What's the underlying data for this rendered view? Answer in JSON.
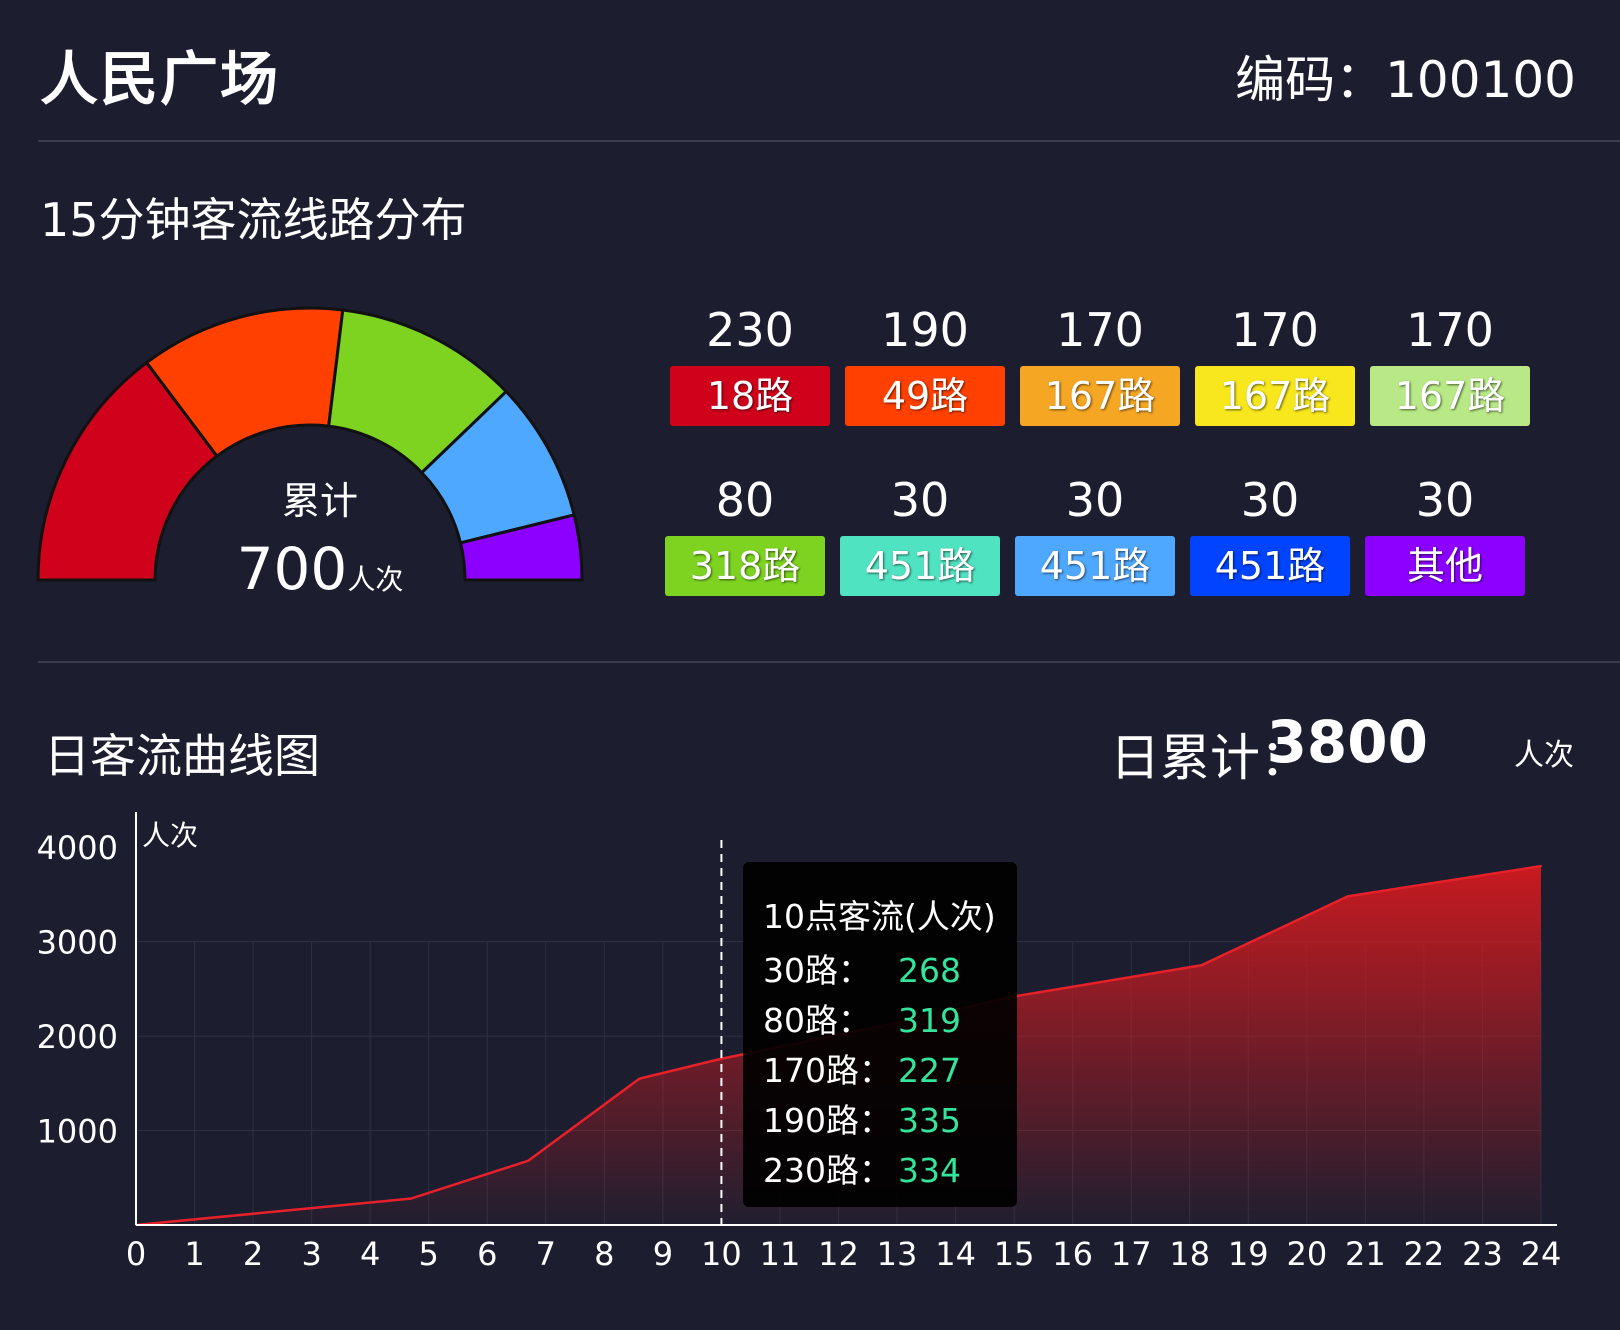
{
  "header": {
    "title": "人民广场",
    "code": "编码：100100"
  },
  "section1": {
    "title": "15分钟客流线路分布"
  },
  "gauge": {
    "label": "累计",
    "total": "700",
    "unit": "人次",
    "segments": [
      {
        "value": 230,
        "color": "#d0021b"
      },
      {
        "value": 190,
        "color": "#ff4000"
      },
      {
        "value": 170,
        "color": "#7ed321"
      },
      {
        "value": 130,
        "color": "#4fa8ff"
      },
      {
        "value": 60,
        "color": "#8b00ff"
      }
    ]
  },
  "legend": [
    {
      "value": "230",
      "route": "18路",
      "color": "#d0021b"
    },
    {
      "value": "190",
      "route": "49路",
      "color": "#ff4000"
    },
    {
      "value": "170",
      "route": "167路",
      "color": "#f5a623"
    },
    {
      "value": "170",
      "route": "167路",
      "color": "#f8e71c"
    },
    {
      "value": "170",
      "route": "167路",
      "color": "#b8e986"
    },
    {
      "value": "80",
      "route": "318路",
      "color": "#7ed321"
    },
    {
      "value": "30",
      "route": "451路",
      "color": "#50e3c2"
    },
    {
      "value": "30",
      "route": "451路",
      "color": "#4fa8ff"
    },
    {
      "value": "30",
      "route": "451路",
      "color": "#0044ff"
    },
    {
      "value": "30",
      "route": "其他",
      "color": "#8b00ff"
    }
  ],
  "section2": {
    "title": "日客流曲线图",
    "total_label": "日累计：",
    "total_value": "3800",
    "total_unit": "人次"
  },
  "tooltip": {
    "title": "10点客流(人次)",
    "rows": [
      {
        "key": "30路：",
        "value": "268"
      },
      {
        "key": "80路：",
        "value": "319"
      },
      {
        "key": "170路：",
        "value": "227"
      },
      {
        "key": "190路：",
        "value": "335"
      },
      {
        "key": "230路：",
        "value": "334"
      }
    ]
  },
  "chart_data": {
    "type": "area",
    "ylabel": "人次",
    "ylim": [
      0,
      4500
    ],
    "yticks": [
      1000,
      2000,
      3000,
      4000
    ],
    "xticks": [
      "0",
      "1",
      "2",
      "3",
      "4",
      "5",
      "6",
      "7",
      "8",
      "9",
      "10",
      "11",
      "12",
      "13",
      "14",
      "15",
      "16",
      "17",
      "18",
      "19",
      "20",
      "21",
      "22",
      "23",
      "24"
    ],
    "xlim": [
      0,
      24
    ],
    "points": [
      [
        0,
        0
      ],
      [
        4.7,
        280
      ],
      [
        6.7,
        680
      ],
      [
        8.6,
        1550
      ],
      [
        10,
        1760
      ],
      [
        13,
        2140
      ],
      [
        15,
        2420
      ],
      [
        18.2,
        2750
      ],
      [
        20.7,
        3480
      ],
      [
        24,
        3800
      ]
    ],
    "highlight_x": 10,
    "line_color": "#e8202a",
    "grid": true
  }
}
